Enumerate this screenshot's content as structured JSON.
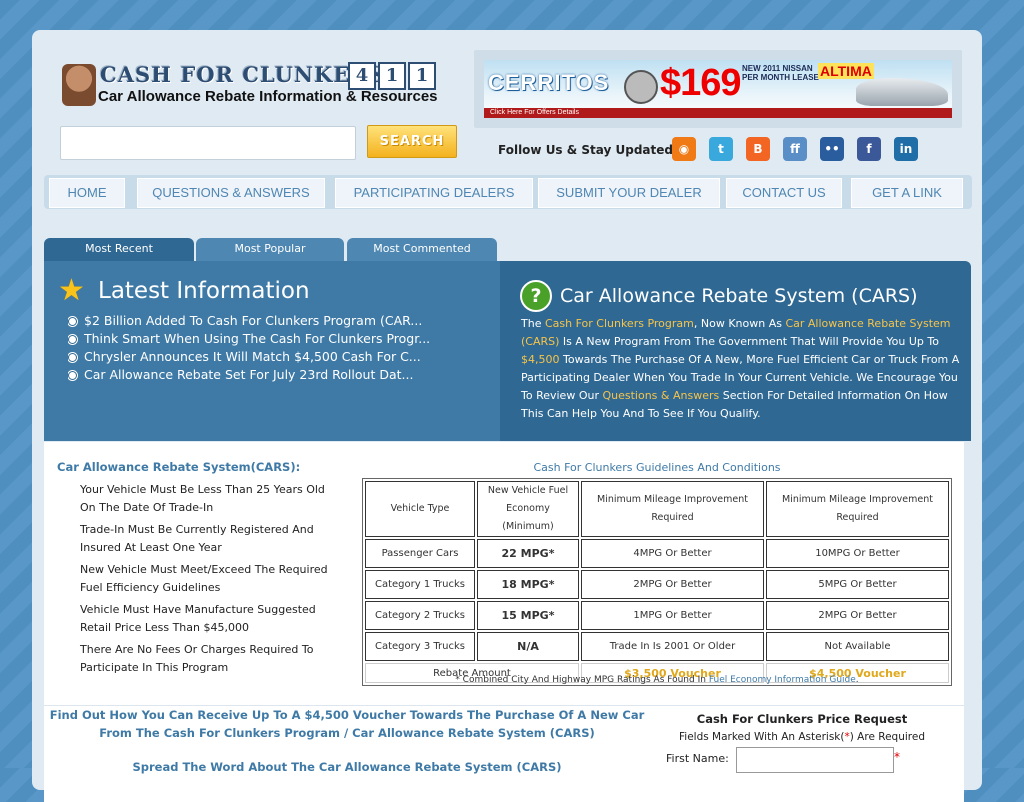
{
  "header": {
    "logo_title": "CASH FOR CLUNKERS",
    "logo_digits": [
      "4",
      "1",
      "1"
    ],
    "logo_subtitle": "Car Allowance Rebate Information & Resources",
    "search_button": "SEARCH",
    "search_value": "",
    "follow_text": "Follow Us & Stay Updated:",
    "social_icons": [
      "rss-icon",
      "twitter-icon",
      "blogger-icon",
      "friendfeed-icon",
      "delicious-icon",
      "facebook-icon",
      "linkedin-icon"
    ],
    "social_glyphs": [
      "◉",
      "t",
      "B",
      "ff",
      "••",
      "f",
      "in"
    ],
    "social_colors": [
      "#f07a16",
      "#39a8dc",
      "#f26522",
      "#5a8ec6",
      "#2a5d9e",
      "#3b5998",
      "#1f6ea8"
    ]
  },
  "banner": {
    "brand": "CERRITOS",
    "price": "$169",
    "offer": "NEW 2011 NISSAN PER MONTH LEASE",
    "model": "ALTIMA",
    "cta": "Click Here For Offers Details"
  },
  "nav": {
    "items": [
      "HOME",
      "QUESTIONS & ANSWERS",
      "PARTICIPATING DEALERS",
      "SUBMIT YOUR DEALER",
      "CONTACT US",
      "GET A LINK"
    ]
  },
  "tabs": [
    "Most Recent",
    "Most Popular",
    "Most Commented"
  ],
  "latest": {
    "title": "Latest Information",
    "items": [
      "$2 Billion Added To Cash For Clunkers Program (CAR...",
      "Think Smart When Using The Cash For Clunkers Progr...",
      "Chrysler Announces It Will Match $4,500 Cash For C...",
      "Car Allowance Rebate Set For July 23rd Rollout Dat..."
    ]
  },
  "cars": {
    "title": "Car Allowance Rebate System (CARS)",
    "t1": "The ",
    "l1": "Cash For Clunkers Program",
    "t2": ", Now Known As ",
    "l2": "Car Allowance Rebate System (CARS)",
    "t3": " Is A New Program From The Government That Will Provide You Up To ",
    "l3": "$4,500",
    "t4": " Towards The Purchase Of A New, More Fuel Efficient Car or Truck From A Participating Dealer When You Trade In Your Current Vehicle. We Encourage You To Review Our ",
    "l4": "Questions & Answers",
    "t5": " Section For Detailed Information On How This Can Help You And To See If You Qualify."
  },
  "requirements": {
    "title": "Car Allowance Rebate System(CARS):",
    "items": [
      "Your Vehicle Must Be Less Than 25 Years Old On The Date Of Trade-In",
      "Trade-In Must Be Currently Registered And Insured At Least One Year",
      "New Vehicle Must Meet/Exceed The Required Fuel Efficiency Guidelines",
      "Vehicle Must Have Manufacture Suggested Retail Price Less Than $45,000",
      "There Are No Fees Or Charges Required To Participate In This Program"
    ]
  },
  "guidelines": {
    "title": "Cash For Clunkers Guidelines And Conditions",
    "headers": [
      "Vehicle Type",
      "New Vehicle Fuel Economy (Minimum)",
      "Minimum Mileage Improvement Required",
      "Minimum Mileage Improvement Required"
    ],
    "rows": [
      [
        "Passenger Cars",
        "22 MPG*",
        "4MPG Or Better",
        "10MPG Or Better"
      ],
      [
        "Category 1 Trucks",
        "18 MPG*",
        "2MPG Or Better",
        "5MPG Or Better"
      ],
      [
        "Category 2 Trucks",
        "15 MPG*",
        "1MPG Or Better",
        "2MPG Or Better"
      ],
      [
        "Category 3 Trucks",
        "N/A",
        "Trade In Is 2001 Or Older",
        "Not Available"
      ]
    ],
    "rebate_label": "Rebate Amount",
    "rebate_values": [
      "$3,500 Voucher",
      "$4,500 Voucher"
    ],
    "footnote": "* Combined City And Highway MPG Ratings As Found In ",
    "footnote_link": "Fuel Economy Information Guide",
    "footnote_end": "."
  },
  "bottom": {
    "find_text": "Find Out How You Can Receive Up To A $4,500 Voucher Towards The Purchase Of A New Car From The Cash For Clunkers Program / Car Allowance Rebate System (CARS)",
    "spread_text": "Spread The Word About The Car Allowance Rebate System (CARS)",
    "price_title": "Cash For Clunkers Price Request",
    "price_sub_1": "Fields Marked With An Asterisk(",
    "price_sub_ast": "*",
    "price_sub_2": ") Are Required",
    "first_name_label": "First Name:",
    "first_name_value": "",
    "required_mark": "*"
  }
}
